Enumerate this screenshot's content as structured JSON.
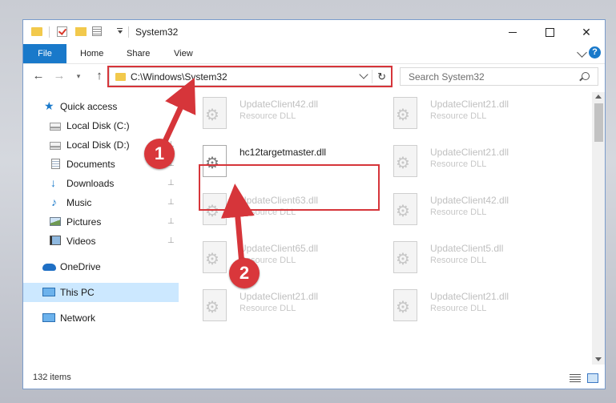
{
  "window": {
    "title": "System32",
    "controls": {
      "minimize": "—",
      "maximize": "☐",
      "close": "✕"
    }
  },
  "ribbon": {
    "file": "File",
    "tabs": [
      "Home",
      "Share",
      "View"
    ],
    "help": "?"
  },
  "address": {
    "path": "C:\\Windows\\System32",
    "refresh_icon": "↻"
  },
  "search": {
    "placeholder": "Search System32"
  },
  "sidebar": {
    "items": [
      {
        "label": "Quick access",
        "icon": "star-icon",
        "pinned": false
      },
      {
        "label": "Local Disk (C:)",
        "icon": "drive-icon",
        "pinned": false
      },
      {
        "label": "Local Disk (D:)",
        "icon": "drive-icon",
        "pinned": true
      },
      {
        "label": "Documents",
        "icon": "documents-icon",
        "pinned": true
      },
      {
        "label": "Downloads",
        "icon": "download-icon",
        "pinned": true
      },
      {
        "label": "Music",
        "icon": "music-icon",
        "pinned": true
      },
      {
        "label": "Pictures",
        "icon": "pictures-icon",
        "pinned": true
      },
      {
        "label": "Videos",
        "icon": "videos-icon",
        "pinned": true
      },
      {
        "label": "OneDrive",
        "icon": "cloud-icon",
        "pinned": false
      },
      {
        "label": "This PC",
        "icon": "computer-icon",
        "pinned": false,
        "selected": true
      },
      {
        "label": "Network",
        "icon": "network-icon",
        "pinned": false
      }
    ],
    "pin_glyph": "📌"
  },
  "files": {
    "left": [
      {
        "name": "UpdateClient42.dll",
        "type": "Resource DLL"
      },
      {
        "name": "hc12targetmaster.dll",
        "type": ""
      },
      {
        "name": "UpdateClient63.dll",
        "type": "Resource DLL"
      },
      {
        "name": "UpdateClient65.dll",
        "type": "Resource DLL"
      },
      {
        "name": "UpdateClient21.dll",
        "type": "Resource DLL"
      }
    ],
    "right": [
      {
        "name": "UpdateClient21.dll",
        "type": "Resource DLL"
      },
      {
        "name": "UpdateClient21.dll",
        "type": "Resource DLL"
      },
      {
        "name": "UpdateClient42.dll",
        "type": "Resource DLL"
      },
      {
        "name": "UpdateClient5.dll",
        "type": "Resource DLL"
      },
      {
        "name": "UpdateClient21.dll",
        "type": "Resource DLL"
      }
    ]
  },
  "status": {
    "item_count": "132 items"
  },
  "annotations": {
    "step1": "1",
    "step2": "2",
    "color": "#d6353a"
  },
  "colors": {
    "accent": "#1979ca",
    "selection": "#cce8ff"
  }
}
